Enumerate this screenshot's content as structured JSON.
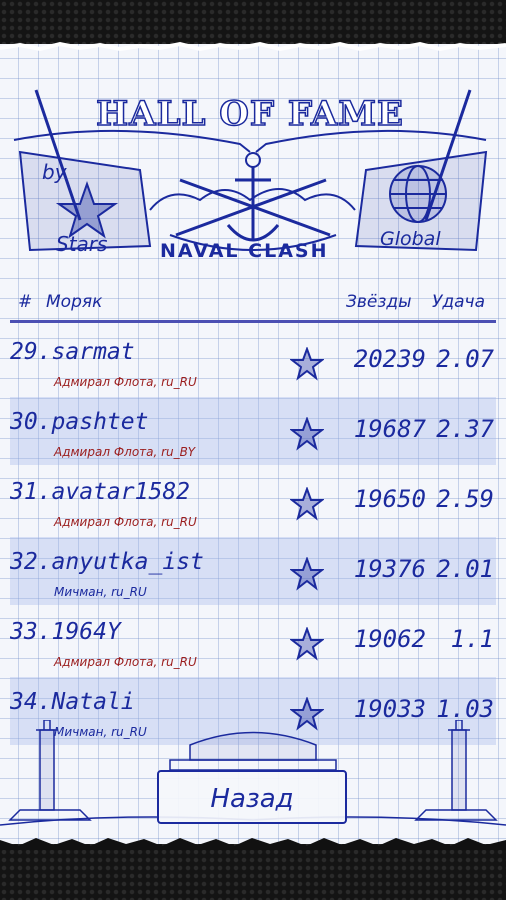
{
  "header": {
    "title": "HALL OF FAME",
    "by_label": "by",
    "stars_label": "Stars",
    "logo_text": "NAVAL CLASH",
    "global_label": "Global"
  },
  "table": {
    "columns": {
      "number": "#",
      "sailor": "Моряк",
      "stars": "Звёзды",
      "luck": "Удача"
    },
    "rows": [
      {
        "name": "29.sarmat",
        "rank": "Адмирал Флота, ru_RU",
        "stars": "20239",
        "luck": "2.07"
      },
      {
        "name": "30.pashtet",
        "rank": "Адмирал Флота, ru_BY",
        "stars": "19687",
        "luck": "2.37"
      },
      {
        "name": "31.avatar1582",
        "rank": "Адмирал Флота, ru_RU",
        "stars": "19650",
        "luck": "2.59"
      },
      {
        "name": "32.anyutka_ist",
        "rank": "Мичман, ru_RU",
        "stars": "19376",
        "luck": "2.01"
      },
      {
        "name": "33.1964Y",
        "rank": "Адмирал Флота, ru_RU",
        "stars": "19062",
        "luck": "1.1"
      },
      {
        "name": "34.Natali",
        "rank": "Мичман, ru_RU",
        "stars": "19033",
        "luck": "1.03"
      }
    ]
  },
  "footer": {
    "back_label": "Назад"
  },
  "colors": {
    "ink": "#1b2a9e",
    "rank_red": "#9b1d1d",
    "paper": "#f4f6fb",
    "row_shade": "#c9d3f0"
  }
}
